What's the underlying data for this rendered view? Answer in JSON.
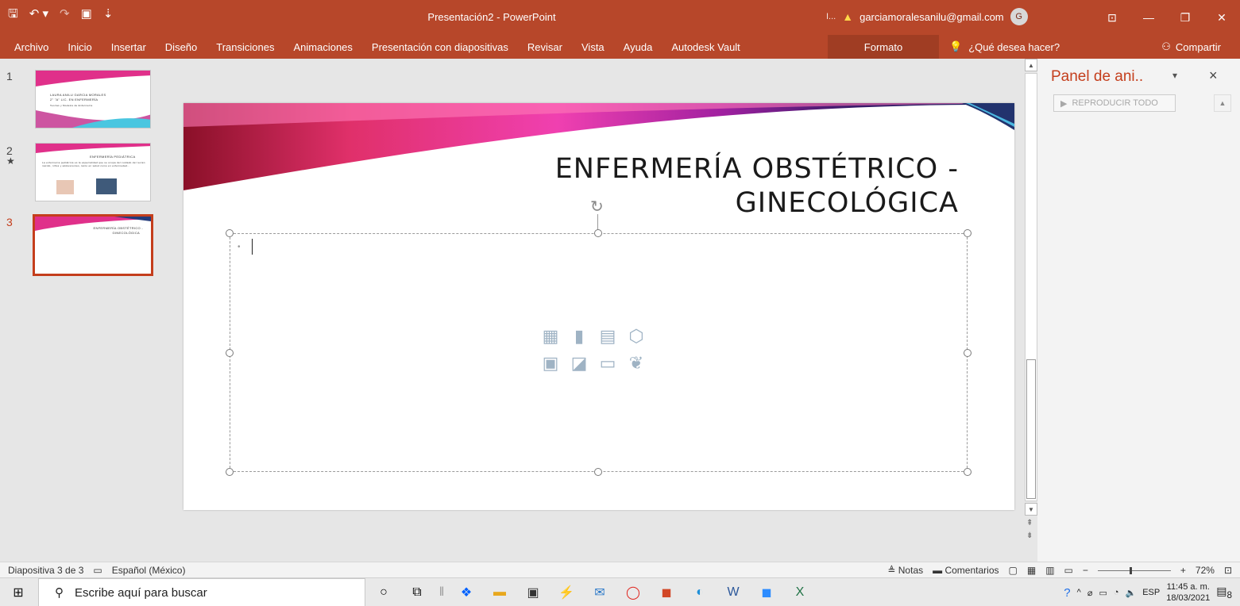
{
  "window": {
    "title": "Presentación2  -  PowerPoint",
    "account_email": "garciamoralesanilu@gmail.com",
    "account_initial": "G",
    "truncated_label": "I..."
  },
  "qat": {
    "save": "🖫",
    "undo": "↶ ▾",
    "redo": "↷",
    "present": "▣",
    "more": "⇣"
  },
  "menu": {
    "items": [
      "Archivo",
      "Inicio",
      "Insertar",
      "Diseño",
      "Transiciones",
      "Animaciones",
      "Presentación con diapositivas",
      "Revisar",
      "Vista",
      "Ayuda",
      "Autodesk Vault"
    ],
    "context_tab": "Formato",
    "tell_me": "¿Qué desea hacer?",
    "share": "Compartir"
  },
  "thumbnails": [
    {
      "num": "1",
      "lines": [
        "LAURA ANILU GARCIA MORALES",
        "2° \"A\" LIC. EN ENFERMERÍA",
        "Teorías y Modelos de Enfermería"
      ]
    },
    {
      "num": "2",
      "marker": "★",
      "lines": [
        "ENFERMERÍA PEDIÁTRICA",
        "La enfermería pediátrica es la especialidad que se ocupa del cuidado del recién nacido, niños y adolescentes, tanto en salud como en enfermedad..."
      ]
    },
    {
      "num": "3",
      "lines": [
        "ENFERMERÍA OBSTÉTRICO -",
        "GINECOLÓGICA"
      ]
    }
  ],
  "slide": {
    "title_line1": "ENFERMERÍA OBSTÉTRICO -",
    "title_line2": "GINECOLÓGICA"
  },
  "animation_pane": {
    "title": "Panel de ani..",
    "play_all": "REPRODUCIR TODO"
  },
  "status": {
    "slide_info": "Diapositiva 3 de 3",
    "language": "Español (México)",
    "notes": "Notas",
    "comments": "Comentarios",
    "zoom": "72%"
  },
  "taskbar": {
    "search_placeholder": "Escribe aquí para buscar",
    "lang": "ESP",
    "time": "11:45 a. m.",
    "date": "18/03/2021",
    "notif_count": "8"
  },
  "colors": {
    "accent": "#b7472a",
    "accent_text": "#c43e1c"
  }
}
